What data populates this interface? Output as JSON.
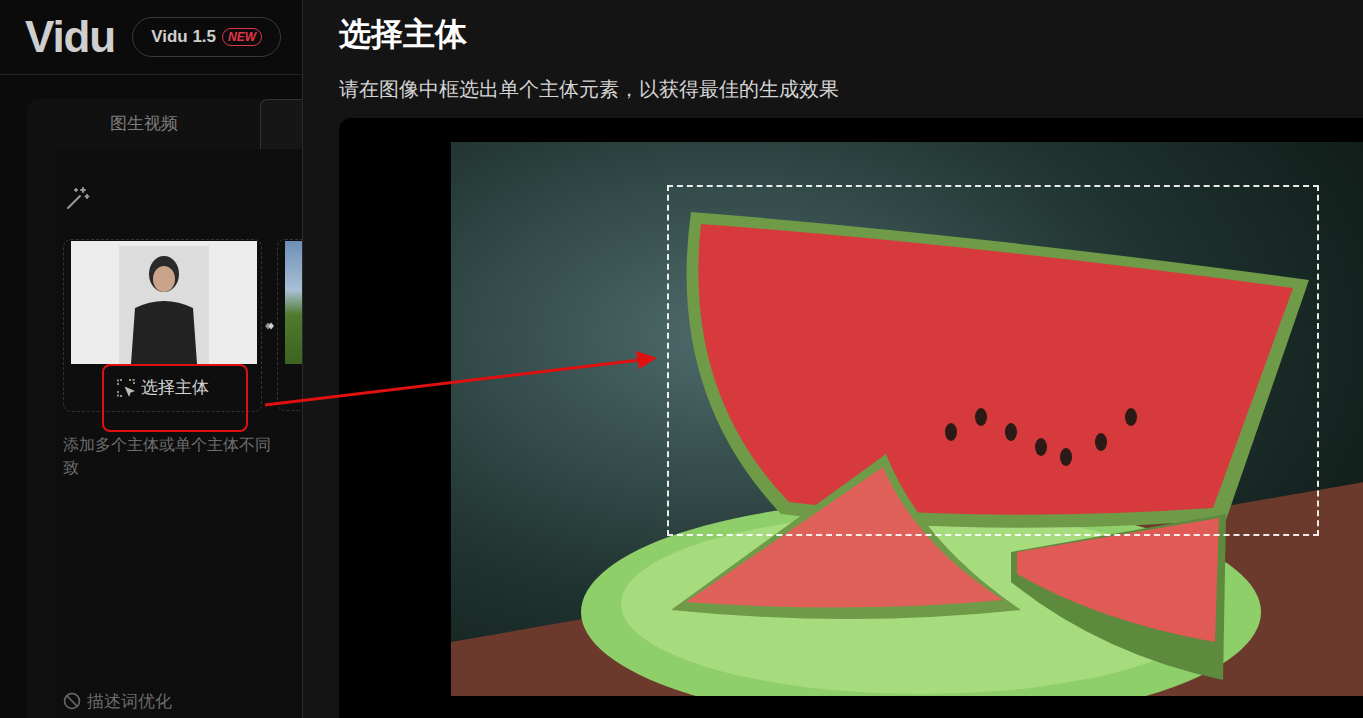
{
  "app": {
    "logo": "Vidu",
    "version": "Vidu 1.5",
    "badge": "NEW"
  },
  "panel": {
    "tabs": [
      {
        "label": "图生视频",
        "selected": false
      },
      {
        "label": "",
        "selected": true
      }
    ],
    "subject_card": {
      "button": "选择主体",
      "highlighted": true
    },
    "hint_lines": [
      "添加多个主体或单个主体不同",
      "致"
    ],
    "prompt_optimize": {
      "label": "描述词优化",
      "enabled": false
    }
  },
  "dialog": {
    "title": "选择主体",
    "subtitle": "请在图像中框选出单个主体元素，以获得最佳的生成效果"
  }
}
